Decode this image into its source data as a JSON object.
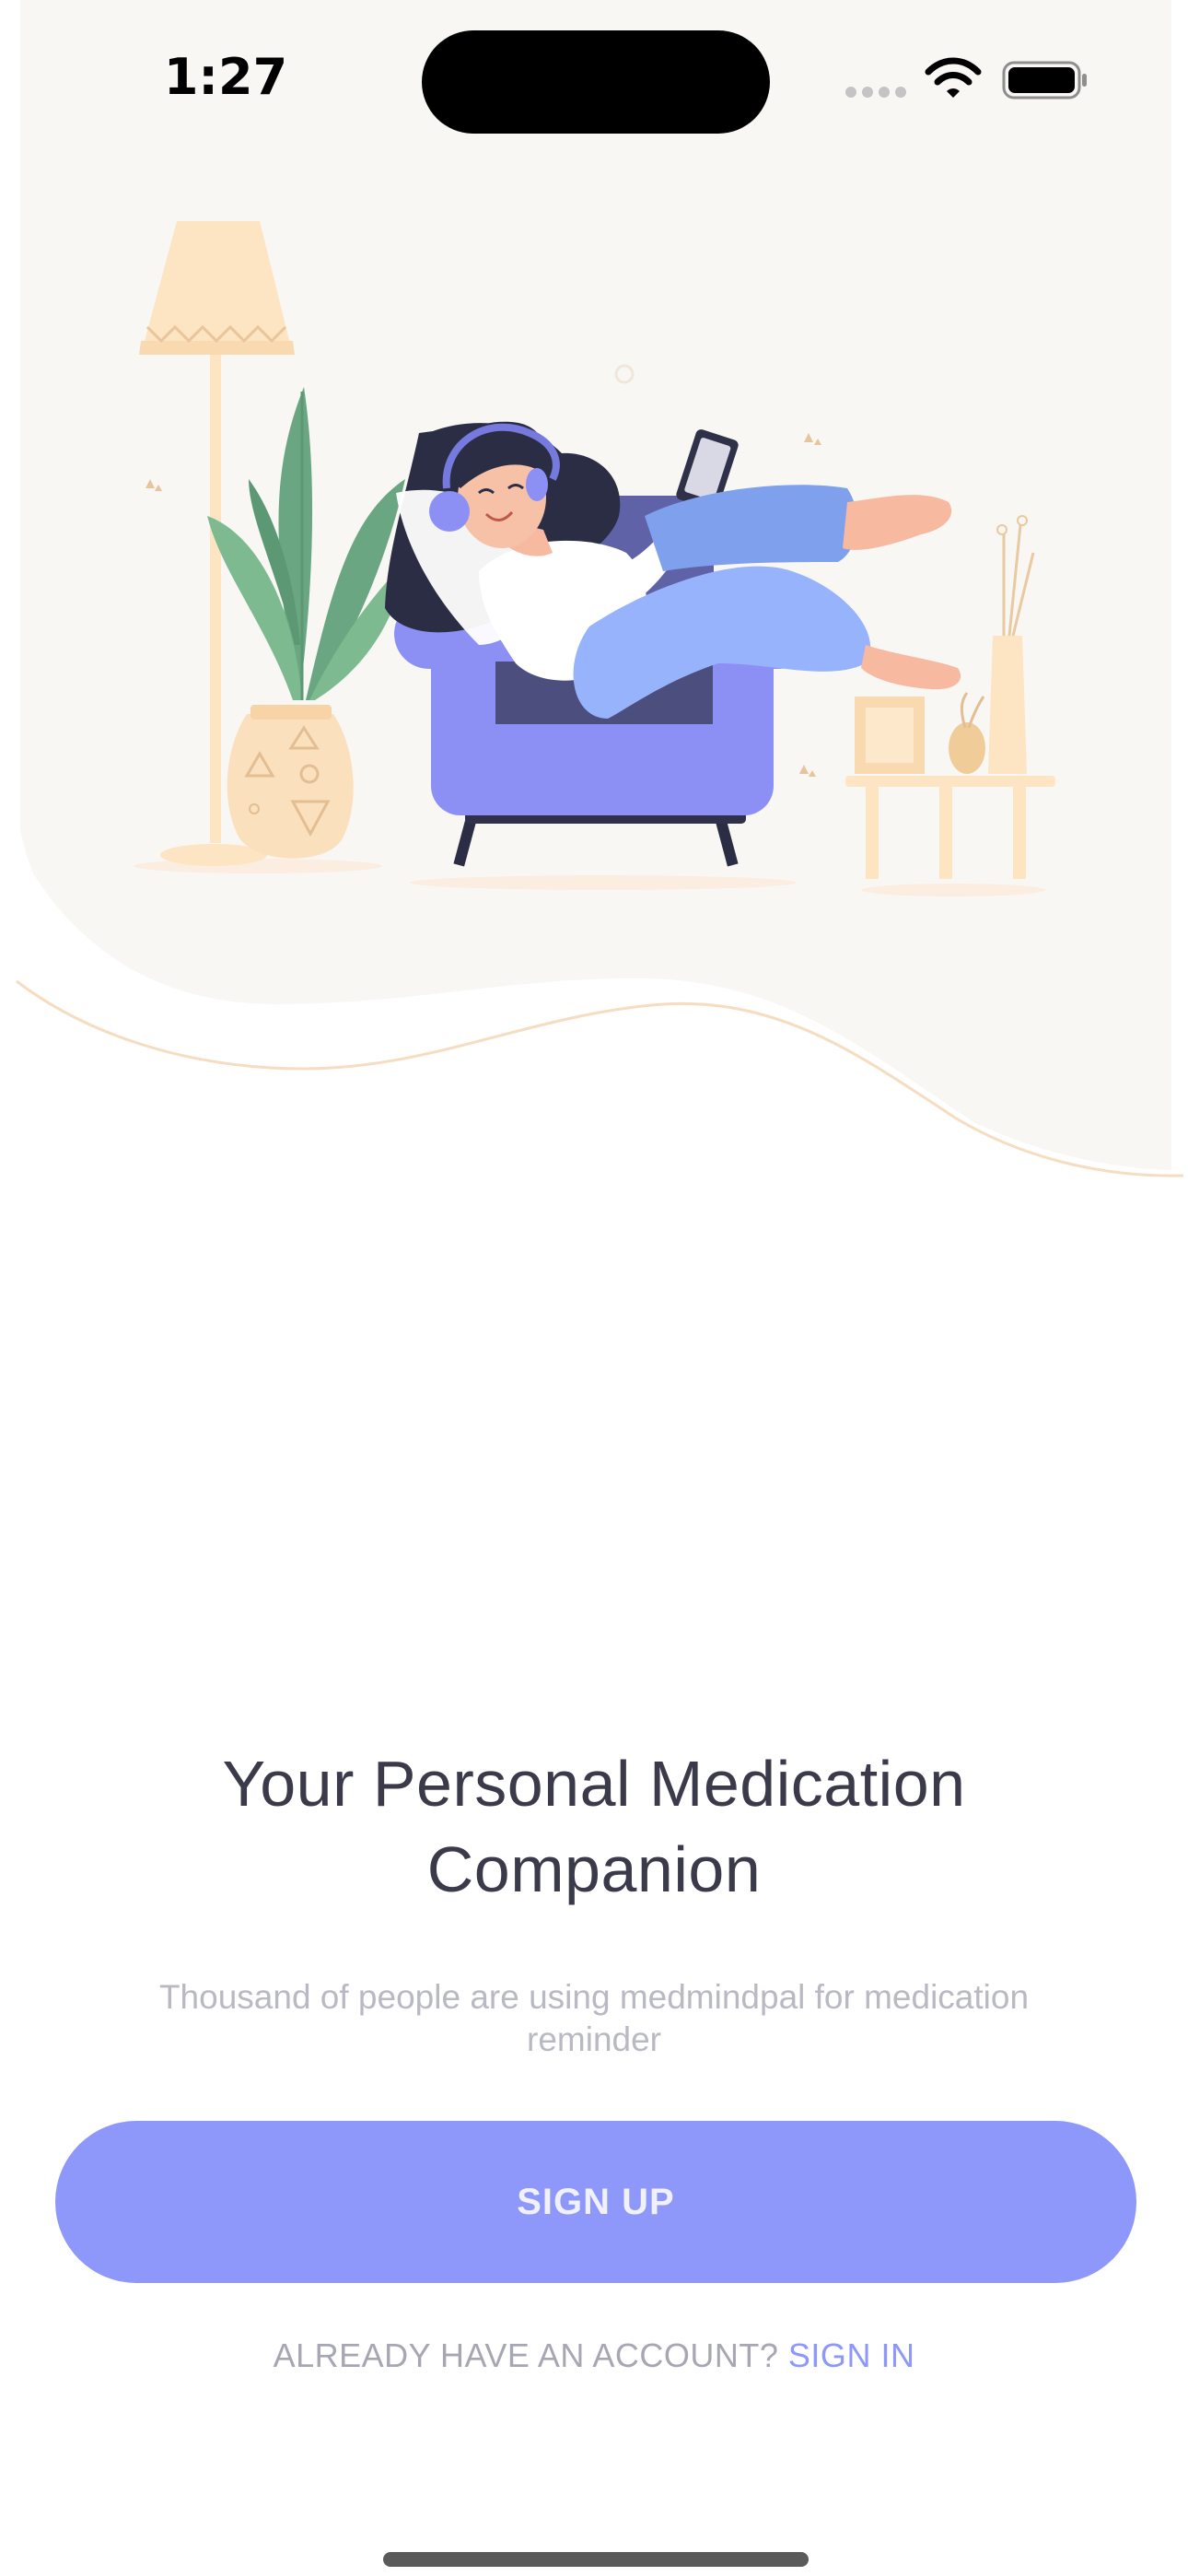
{
  "status_bar": {
    "time": "1:27"
  },
  "illustration": {
    "icon": "woman-relaxing-on-armchair-illustration"
  },
  "onboarding": {
    "headline": "Your Personal Medication Companion",
    "subtitle": "Thousand of people are using medmindpal for medication reminder",
    "signup_label": "SIGN UP",
    "account_prompt": "ALREADY HAVE AN ACCOUNT?",
    "signin_label": "SIGN IN"
  },
  "colors": {
    "accent": "#8e97fa",
    "headline": "#3b3a4a",
    "subtitle": "#b9b9c3",
    "hero_background": "#f9f7f4",
    "wave_line": "#f6dcc0"
  }
}
